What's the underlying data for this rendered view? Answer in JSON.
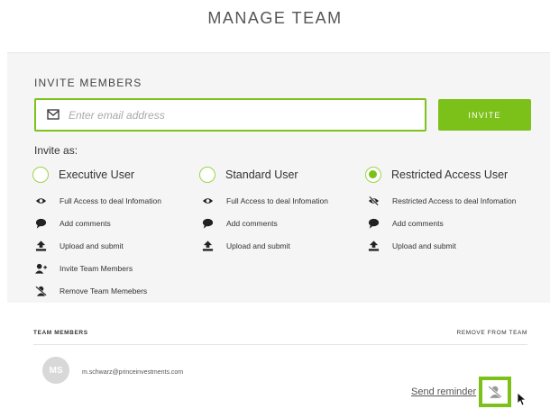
{
  "header": {
    "title": "MANAGE TEAM"
  },
  "invite": {
    "heading": "INVITE MEMBERS",
    "email_placeholder": "Enter email address",
    "email_value": "",
    "button_label": "INVITE",
    "invite_as_label": "Invite as:",
    "accent_color": "#7cc11a"
  },
  "roles": [
    {
      "label": "Executive User",
      "selected": false,
      "permissions": [
        {
          "icon": "eye-icon",
          "text": "Full Access to deal Infomation"
        },
        {
          "icon": "comment-icon",
          "text": "Add comments"
        },
        {
          "icon": "upload-icon",
          "text": "Upload and submit"
        },
        {
          "icon": "add-user-icon",
          "text": "Invite Team Members"
        },
        {
          "icon": "remove-user-icon",
          "text": "Remove Team Memebers"
        }
      ]
    },
    {
      "label": "Standard User",
      "selected": false,
      "permissions": [
        {
          "icon": "eye-icon",
          "text": "Full Access to deal Infomation"
        },
        {
          "icon": "comment-icon",
          "text": "Add comments"
        },
        {
          "icon": "upload-icon",
          "text": "Upload and submit"
        }
      ]
    },
    {
      "label": "Restricted Access User",
      "selected": true,
      "permissions": [
        {
          "icon": "eye-slash-icon",
          "text": "Restricted Access to deal Infomation"
        },
        {
          "icon": "comment-icon",
          "text": "Add comments"
        },
        {
          "icon": "upload-icon",
          "text": "Upload and submit"
        }
      ]
    }
  ],
  "team": {
    "title": "TEAM MEMBERS",
    "remove_label": "REMOVE FROM TEAM",
    "members": [
      {
        "initials": "MS",
        "email": "m.schwarz@princeinvestments.com",
        "reminder_label": "Send reminder"
      }
    ]
  }
}
